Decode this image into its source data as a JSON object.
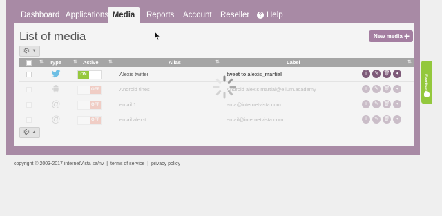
{
  "nav": {
    "items": [
      {
        "label": "Dashboard"
      },
      {
        "label": "Applications"
      },
      {
        "label": "Media"
      },
      {
        "label": "Reports"
      },
      {
        "label": "Account"
      },
      {
        "label": "Reseller"
      },
      {
        "label": "Help"
      }
    ],
    "active": "Media"
  },
  "page": {
    "title": "List of media",
    "new_button": "New media"
  },
  "table": {
    "columns": {
      "type": "Type",
      "active": "Active",
      "alias": "Alias",
      "label": "Label"
    },
    "rows": [
      {
        "type_icon": "twitter-icon",
        "toggle": "ON",
        "alias": "Alexis twitter",
        "label": "tweet to alexis_martial",
        "enabled": true
      },
      {
        "type_icon": "android-icon",
        "toggle": "OFF",
        "alias": "Android tines",
        "label": "Android alexis martial@ellum.academy",
        "enabled": false
      },
      {
        "type_icon": "at-icon",
        "toggle": "OFF",
        "alias": "email 1",
        "label": "ama@internetvista.com",
        "enabled": false
      },
      {
        "type_icon": "at-icon",
        "toggle": "OFF",
        "alias": "email alex-t",
        "label": "email@internetvista.com",
        "enabled": false
      }
    ]
  },
  "feedback": "Feedback",
  "footer": {
    "copyright": "copyright © 2003-2017 internetVista sa/nv",
    "sep": "|",
    "terms": "terms of service",
    "privacy": "privacy policy"
  },
  "colors": {
    "accent": "#a88aa5",
    "on": "#96c83e",
    "off": "#e9866f",
    "feedback": "#93c83d"
  }
}
